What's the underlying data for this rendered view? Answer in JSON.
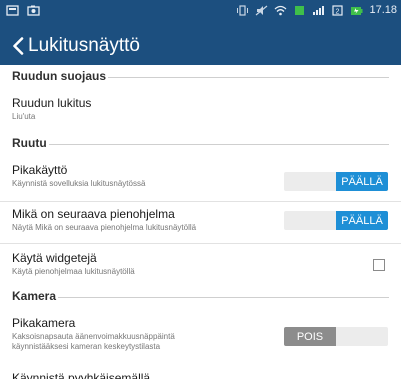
{
  "status_bar": {
    "time": "17.18",
    "icons": [
      "notification-icon",
      "image-icon",
      "vibrate-icon",
      "mute-icon",
      "wifi-icon",
      "data-icon",
      "signal-icon",
      "sim-icon",
      "battery-icon"
    ],
    "accent": "#1c4f7f"
  },
  "app_bar": {
    "title": "Lukitusnäyttö",
    "back_icon": "chevron-left-icon"
  },
  "sections": {
    "screen_lock": {
      "label": "Ruudun suojaus"
    },
    "screen": {
      "label": "Ruutu"
    },
    "camera": {
      "label": "Kamera"
    }
  },
  "settings": {
    "screen_lock": {
      "title": "Ruudun lukitus",
      "subtitle": "Liu'uta"
    },
    "quick_access": {
      "title": "Pikakäyttö",
      "subtitle": "Käynnistä sovelluksia lukitusnäytössä",
      "state": "PÄÄLLÄ"
    },
    "next_widget": {
      "title": "Mikä on seuraava pienohjelma",
      "subtitle": "Näytä Mikä on seuraava pienohjelma lukitusnäytöllä",
      "state": "PÄÄLLÄ"
    },
    "use_widgets": {
      "title": "Käytä widgetejä",
      "subtitle": "Käytä pienohjelmaa lukitusnäytöllä",
      "checked": false
    },
    "quick_camera": {
      "title": "Pikakamera",
      "subtitle_line1": "Kaksoisnapsauta äänenvoimakkuusnäppäintä",
      "subtitle_line2": "käynnistääksesi kameran keskeytystilasta",
      "state": "POIS"
    },
    "cut_row": {
      "title": "Käynnistä pyyhkäisemällä"
    }
  },
  "colors": {
    "toggle_on": "#1e8fd6",
    "toggle_off": "#8c8c8c",
    "toggle_track": "#ececec"
  }
}
